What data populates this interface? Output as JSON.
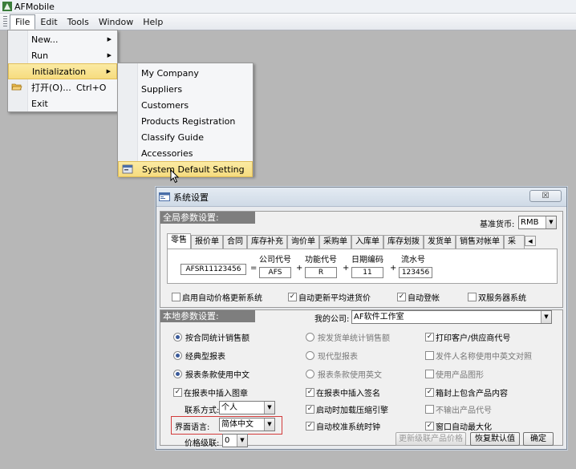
{
  "window": {
    "title": "AFMobile"
  },
  "menubar": [
    "File",
    "Edit",
    "Tools",
    "Window",
    "Help"
  ],
  "file_menu": [
    {
      "label": "New...",
      "submenu": true
    },
    {
      "label": "Run",
      "submenu": true
    },
    {
      "label": "Initialization",
      "submenu": true
    },
    {
      "label": "打开(O)...",
      "shortcut": "Ctrl+O"
    },
    {
      "label": "Exit"
    }
  ],
  "init_menu": [
    "My Company",
    "Suppliers",
    "Customers",
    "Products Registration",
    "Classify Guide",
    "Accessories",
    "System Default Setting"
  ],
  "dialog": {
    "title": "系统设置",
    "close": "☒",
    "global": {
      "header": "全局参数设置:",
      "base_currency_label": "基准货币:",
      "base_currency": "RMB",
      "tabs": [
        "零售",
        "报价单",
        "合同",
        "库存补充",
        "询价单",
        "采购单",
        "入库单",
        "库存划拨",
        "发货单",
        "销售对帐单",
        "采购"
      ],
      "code_sample": "AFSR11123456",
      "equals": "=",
      "plus": "+",
      "parts": [
        {
          "label": "公司代号",
          "value": "AFS"
        },
        {
          "label": "功能代号",
          "value": "R"
        },
        {
          "label": "日期编码",
          "value": "11"
        },
        {
          "label": "流水号",
          "value": "123456"
        }
      ],
      "options": [
        {
          "label": "启用自动价格更新系统",
          "checked": false
        },
        {
          "label": "自动更新平均进货价",
          "checked": true
        },
        {
          "label": "自动登帐",
          "checked": true
        },
        {
          "label": "双服务器系统",
          "checked": false
        }
      ]
    },
    "local": {
      "header": "本地参数设置:",
      "my_company_label": "我的公司:",
      "my_company": "AF软件工作室",
      "col1": [
        {
          "type": "radio",
          "label": "按合同统计销售额",
          "checked": true
        },
        {
          "type": "radio",
          "label": "经典型报表",
          "checked": true
        },
        {
          "type": "radio",
          "label": "报表条款使用中文",
          "checked": true
        },
        {
          "type": "check",
          "label": "在报表中插入图章",
          "checked": true
        }
      ],
      "col2": [
        {
          "type": "radio",
          "label": "按发货单统计销售额",
          "checked": false
        },
        {
          "type": "radio",
          "label": "现代型报表",
          "checked": false
        },
        {
          "type": "radio",
          "label": "报表条款使用英文",
          "checked": false
        },
        {
          "type": "check",
          "label": "在报表中插入签名",
          "checked": true
        },
        {
          "type": "check",
          "label": "启动时加载压缩引擎",
          "checked": true
        },
        {
          "type": "check",
          "label": "自动校准系统时钟",
          "checked": true
        }
      ],
      "col3": [
        {
          "label": "打印客户/供应商代号",
          "checked": true
        },
        {
          "label": "发件人名称使用中英文对照",
          "checked": false
        },
        {
          "label": "使用产品图形",
          "checked": false
        },
        {
          "label": "箱封上包含产品内容",
          "checked": true
        },
        {
          "label": "不输出产品代号",
          "checked": false
        },
        {
          "label": "窗口自动最大化",
          "checked": true
        }
      ],
      "contact_label": "联系方式:",
      "contact": "个人",
      "language_label": "界面语言:",
      "language": "简体中文",
      "price_level_label": "价格级联:",
      "price_level": "0",
      "buttons": {
        "update": "更新级联产品价格",
        "reset": "恢复默认值",
        "ok": "确定"
      }
    }
  },
  "check_mark": "✓",
  "arrow_right": "▶",
  "arrow_down": "▼",
  "tab_nav": "◀ ▶"
}
